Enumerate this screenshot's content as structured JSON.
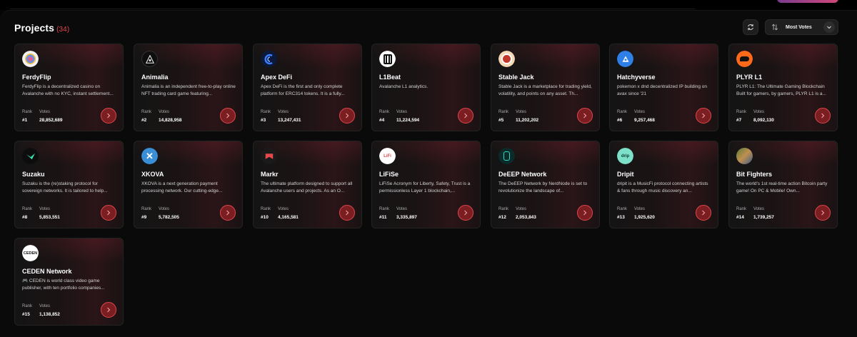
{
  "header": {
    "title": "Projects",
    "count": "(34)"
  },
  "toolbar": {
    "refresh_icon": "refresh-icon",
    "sort_label": "Most Votes",
    "sort_icon": "sort-arrows-icon",
    "dropdown_icon": "chevron-down-icon"
  },
  "labels": {
    "rank": "Rank",
    "votes": "Votes"
  },
  "colors": {
    "accent": "#e5484d",
    "card_bg": "#1a1314",
    "background": "#0a0a0a"
  },
  "projects": [
    {
      "name": "FerdyFlip",
      "desc": "FerdyFlip is a decentralized casino on Avalanche with no KYC, instant settlement...",
      "rank": "#1",
      "votes": "28,852,689"
    },
    {
      "name": "Animalia",
      "desc": "Animalia is an independent free-to-play online NFT trading card game featuring...",
      "rank": "#2",
      "votes": "14,828,958"
    },
    {
      "name": "Apex DeFi",
      "desc": "Apex DeFi is the first and only complete platform for ERC314 tokens. It is a fully...",
      "rank": "#3",
      "votes": "13,247,431"
    },
    {
      "name": "L1Beat",
      "desc": "Avalanche L1 analytics.",
      "rank": "#4",
      "votes": "11,224,594"
    },
    {
      "name": "Stable Jack",
      "desc": "Stable Jack is a marketplace for trading yield, volatility, and points on any asset. Th...",
      "rank": "#5",
      "votes": "11,202,202"
    },
    {
      "name": "Hatchyverse",
      "desc": "pokemon x dnd decentralized IP building on avax since '21",
      "rank": "#6",
      "votes": "9,257,468"
    },
    {
      "name": "PLYR L1",
      "desc": "PLYR L1: The Ultimate Gaming Blockchain Built for gamers, by gamers, PLYR L1 is a...",
      "rank": "#7",
      "votes": "8,092,130"
    },
    {
      "name": "Suzaku",
      "desc": "Suzaku is the (re)staking protocol for sovereign networks. It is tailored to help...",
      "rank": "#8",
      "votes": "5,853,551"
    },
    {
      "name": "XKOVA",
      "desc": "XKOVA is a next generation payment processing network. Our cutting-edge...",
      "rank": "#9",
      "votes": "5,782,505"
    },
    {
      "name": "Markr",
      "desc": "The ultimate platform designed to support all Avalanche users and projects. As an O...",
      "rank": "#10",
      "votes": "4,165,581"
    },
    {
      "name": "LiFiSe",
      "desc": "LiFiSe Acronym for Liberty, Safety, Trust is a permissionless Layer 1 blockchain,...",
      "rank": "#11",
      "votes": "3,335,897"
    },
    {
      "name": "DeEEP Network",
      "desc": "The DeEEP Network by NerdNode is set to revolutionize the landscape of...",
      "rank": "#12",
      "votes": "2,053,843"
    },
    {
      "name": "Dripit",
      "desc": "dripit is a MusicFi protocol connecting artists & fans through music discovery an...",
      "rank": "#13",
      "votes": "1,925,620"
    },
    {
      "name": "Bit Fighters",
      "desc": "The world's 1st real-time action Bitcoin party game! On PC & Mobile! Own...",
      "rank": "#14",
      "votes": "1,739,257"
    },
    {
      "name": "CEDEN Network",
      "desc": "🎮 CEDEN is world class video game publisher, with ten portfolio companies...",
      "rank": "#15",
      "votes": "1,138,852",
      "logo_text": "CEDEN"
    }
  ]
}
